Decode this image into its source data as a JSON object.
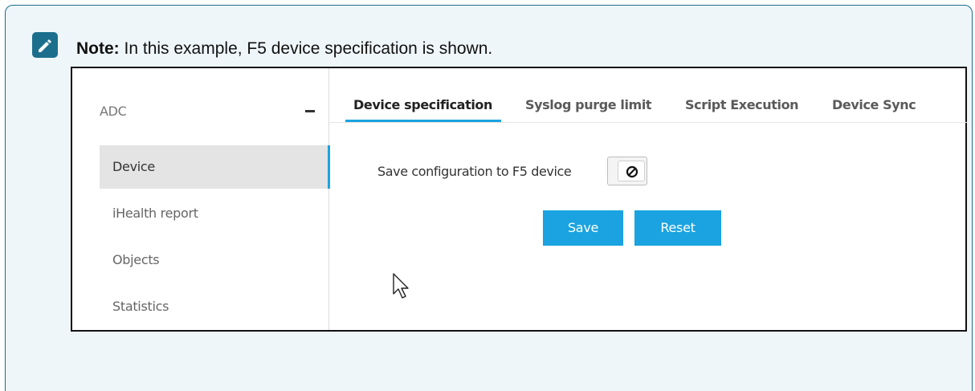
{
  "note": {
    "label": "Note:",
    "text": " In this example, F5 device specification is shown.",
    "icon": "pencil-icon"
  },
  "sidebar": {
    "header": "ADC",
    "collapse_icon": "minus-icon",
    "items": [
      {
        "label": "Device",
        "active": true
      },
      {
        "label": "iHealth report",
        "active": false
      },
      {
        "label": "Objects",
        "active": false
      },
      {
        "label": "Statistics",
        "active": false
      }
    ]
  },
  "tabs": [
    {
      "label": "Device specification",
      "active": true
    },
    {
      "label": "Syslog purge limit",
      "active": false
    },
    {
      "label": "Script Execution",
      "active": false
    },
    {
      "label": "Device Sync",
      "active": false
    }
  ],
  "form": {
    "save_config_label": "Save configuration to F5 device",
    "toggle_state": "off",
    "toggle_icon": "prohibited-icon"
  },
  "buttons": {
    "save": "Save",
    "reset": "Reset"
  },
  "colors": {
    "accent": "#1aa3e0",
    "note_border": "#1b6f8d",
    "note_bg": "#eef6fa"
  }
}
